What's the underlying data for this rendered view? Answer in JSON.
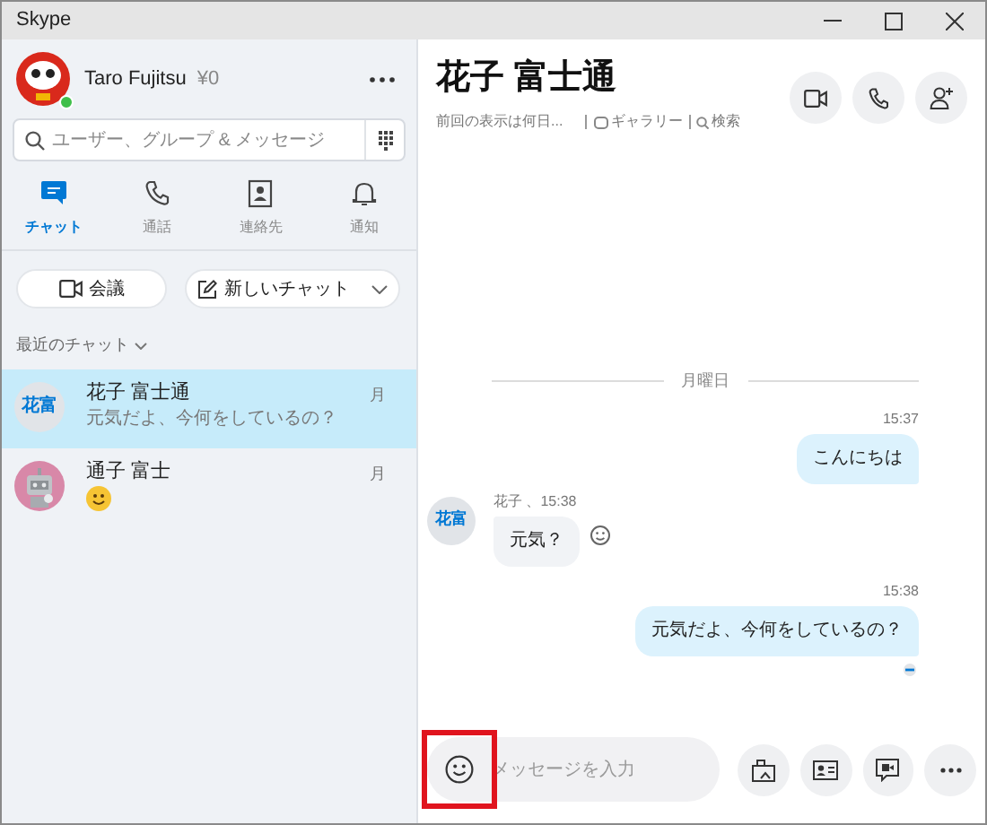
{
  "window": {
    "title": "Skype"
  },
  "profile": {
    "name": "Taro Fujitsu",
    "credit": "¥0",
    "online": true
  },
  "search": {
    "placeholder": "ユーザー、グループ & メッセージ"
  },
  "nav_tabs": [
    {
      "label": "チャット",
      "selected": true
    },
    {
      "label": "通話",
      "selected": false
    },
    {
      "label": "連絡先",
      "selected": false
    },
    {
      "label": "通知",
      "selected": false
    }
  ],
  "actions": [
    "会議",
    "新しいチャット"
  ],
  "recent_label": "最近のチャット",
  "chats": [
    {
      "avatar": {
        "kind": "initials",
        "text": "花富"
      },
      "name": "花子 富士通",
      "time": "月",
      "preview": {
        "kind": "text",
        "text": "元気だよ、今何をしているの？"
      },
      "selected": true
    },
    {
      "name": "通子 富士",
      "time": "月",
      "preview": {
        "kind": "emoji"
      },
      "selected": false
    }
  ],
  "conversation": {
    "title": "花子 富士通",
    "last_seen": "前回の表示は何日...",
    "gallery": "ギャラリー",
    "search": "検索"
  },
  "messages": [
    {
      "kind": "divider",
      "text": "月曜日"
    },
    {
      "kind": "outgoing",
      "time": "15:37",
      "text": "こんにちは",
      "read": false
    },
    {
      "kind": "incoming",
      "initials": "花富",
      "meta": "花子 、15:38",
      "text": "元気？"
    },
    {
      "kind": "outgoing",
      "time": "15:38",
      "text": "元気だよ、今何をしているの？",
      "read": true
    }
  ],
  "composer": {
    "placeholder": "メッセージを入力",
    "emoji_highlighted": true
  }
}
